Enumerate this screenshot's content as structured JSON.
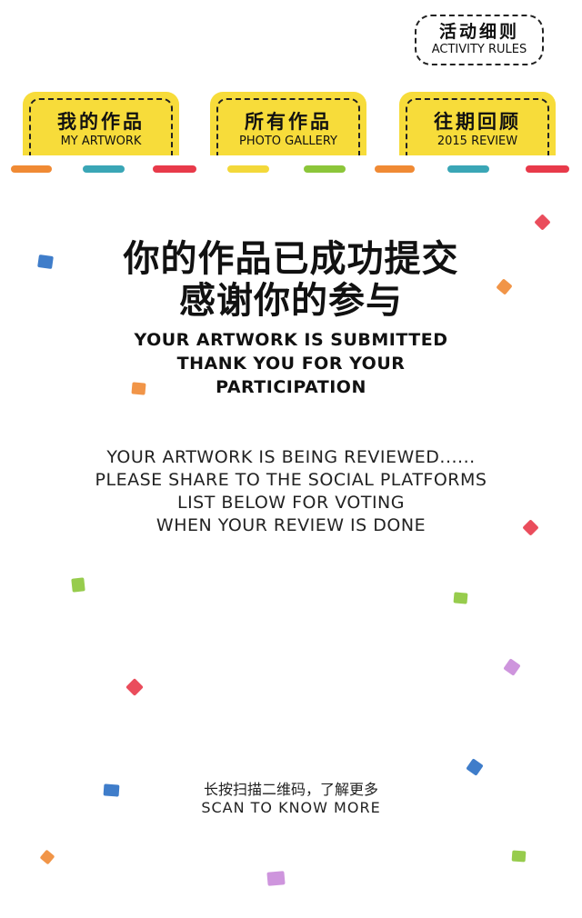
{
  "rules_button": {
    "cn": "活动细则",
    "en": "ACTIVITY RULES"
  },
  "tabs": [
    {
      "cn": "我的作品",
      "en": "MY ARTWORK"
    },
    {
      "cn": "所有作品",
      "en": "PHOTO GALLERY"
    },
    {
      "cn": "往期回顾",
      "en": "2015 REVIEW"
    }
  ],
  "headline": {
    "cn_line1": "你的作品已成功提交",
    "cn_line2": "感谢你的参与",
    "en_line1": "YOUR ARTWORK IS SUBMITTED",
    "en_line2": "THANK YOU FOR YOUR",
    "en_line3": "PARTICIPATION"
  },
  "review": {
    "line1": "YOUR ARTWORK IS BEING REVIEWED......",
    "line2": "PLEASE SHARE TO THE SOCIAL PLATFORMS",
    "line3": "LIST BELOW FOR VOTING",
    "line4": "WHEN YOUR REVIEW IS DONE"
  },
  "scan": {
    "cn": "长按扫描二维码，了解更多",
    "en": "SCAN TO KNOW MORE"
  },
  "colors": {
    "tab_yellow": "#f7dc3a",
    "orange": "#f08a34",
    "teal": "#3aa6b6",
    "red": "#e83a4a",
    "yellow": "#f3d83a",
    "green": "#8cc63a",
    "blue": "#2a6fc4",
    "purple": "#c98ad9"
  }
}
